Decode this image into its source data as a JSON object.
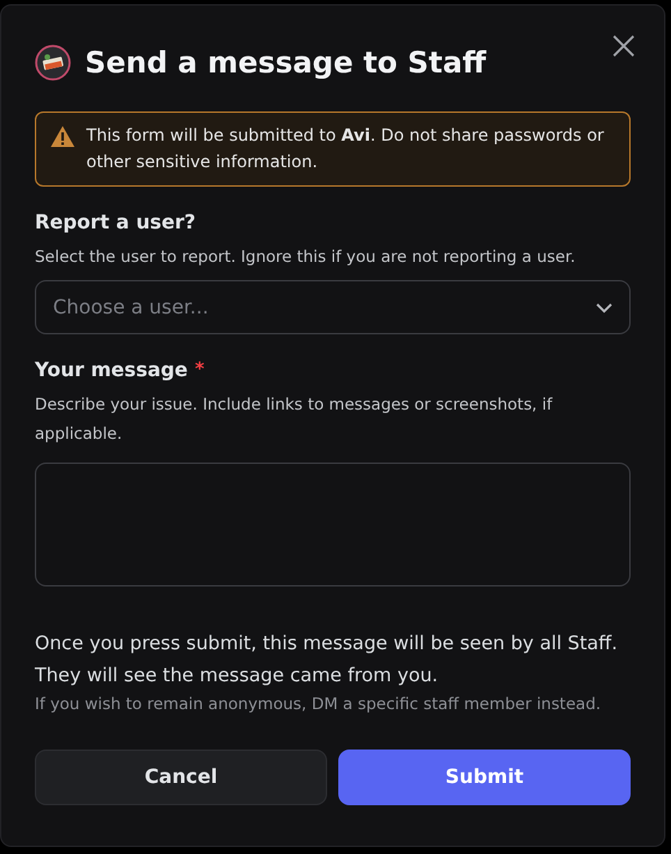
{
  "dialog": {
    "title": "Send a message to Staff",
    "warning": "This form will be submitted to **Avi**. Do not share passwords or other sensitive information."
  },
  "fields": [
    {
      "kind": "select",
      "label": "Report a user?",
      "description": "Select the user to report. Ignore this if you are not reporting a user.",
      "placeholder": "Choose a user..."
    },
    {
      "kind": "textarea",
      "label": "Your message",
      "required_mark": "*",
      "description": "Describe your issue. Include links to messages or screenshots, if applicable."
    }
  ],
  "notice": "Once you press submit, this message will be seen by all Staff. They will see the message came from you.",
  "hint": "If you wish to remain anonymous, DM a specific staff member instead.",
  "buttons": [
    {
      "label": "Cancel",
      "kind": "secondary"
    },
    {
      "label": "Submit",
      "kind": "primary"
    }
  ]
}
